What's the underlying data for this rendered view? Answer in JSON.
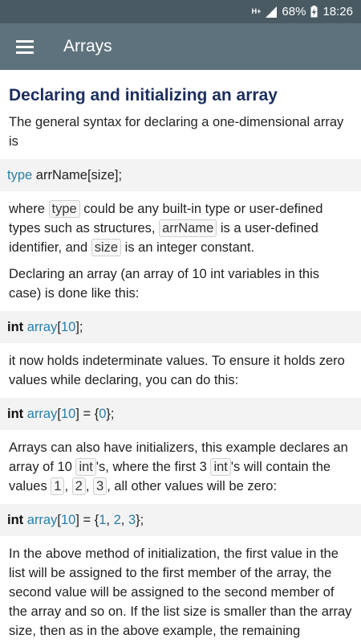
{
  "status_bar": {
    "network": "H+",
    "battery_percent": "68%",
    "time": "18:26"
  },
  "app_bar": {
    "title": "Arrays",
    "menu_icon": "hamburger-menu-icon"
  },
  "content": {
    "heading": "Declaring and initializing an array",
    "intro": "The general syntax for declaring a one-dimensional array is",
    "code1": {
      "type": "type",
      "rest": " arrName[size];"
    },
    "para2": {
      "t1": "where ",
      "c1": "type",
      "t2": " could be any built-in type or user-defined types such as structures, ",
      "c2": "arrName",
      "t3": " is a user-defined identifier, and ",
      "c3": "size",
      "t4": " is an integer constant."
    },
    "para3": "Declaring an array (an array of 10 int variables in this case) is done like this:",
    "code2": {
      "kw": "int",
      "id": "array",
      "open": "[",
      "num": "10",
      "close": "];"
    },
    "para4": "it now holds indeterminate values. To ensure it holds zero values while declaring, you can do this:",
    "code3": {
      "kw": "int",
      "id": "array",
      "open": "[",
      "num": "10",
      "mid": "] = {",
      "num2": "0",
      "close": "};"
    },
    "para5": {
      "t1": "Arrays can also have initializers, this example declares an array of 10 ",
      "c1": "int",
      "t2": "'s, where the first 3 ",
      "c2": "int",
      "t3": "'s will contain the values ",
      "c3": "1",
      "t4": ", ",
      "c4": "2",
      "t5": ", ",
      "c5": "3",
      "t6": ", all other values will be zero:"
    },
    "code4": {
      "kw": "int",
      "id": "array",
      "open": "[",
      "num": "10",
      "mid": "] = {",
      "n1": "1",
      "s1": ", ",
      "n2": "2",
      "s2": ", ",
      "n3": "3",
      "close": "};"
    },
    "para6": "In the above method of initialization, the first value in the list will be assigned to the first member of the array, the second value will be assigned to the second member of the array and so on. If the list size is smaller than the array size, then as in the above example, the remaining members of the array will be"
  }
}
